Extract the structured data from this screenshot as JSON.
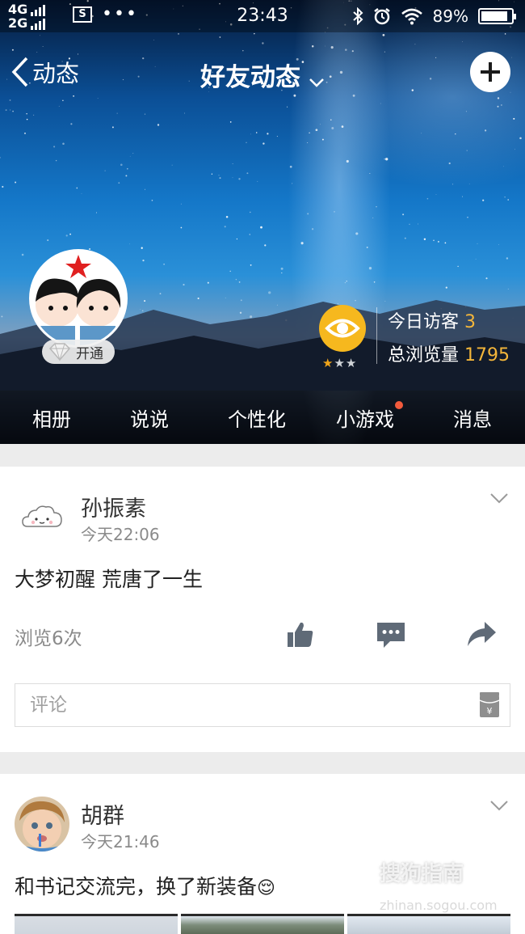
{
  "status_bar": {
    "network_top": "4G",
    "network_bottom": "2G",
    "sim_icon": "S",
    "more": "•••",
    "time": "23:43",
    "battery": "89%",
    "battery_level": 0.89,
    "icons": [
      "bluetooth-icon",
      "alarm-icon",
      "wifi-icon",
      "battery-icon"
    ]
  },
  "header": {
    "back_label": "动态",
    "title": "好友动态",
    "add_icon": "plus-icon"
  },
  "profile": {
    "vip_label": "开通",
    "visits_today_label": "今日访客",
    "visits_today": "3",
    "visits_total_label": "总浏览量",
    "visits_total": "1795",
    "rating_stars": 1,
    "rating_max": 3
  },
  "nav": {
    "items": [
      {
        "label": "相册"
      },
      {
        "label": "说说"
      },
      {
        "label": "个性化"
      },
      {
        "label": "小游戏",
        "badge": true
      },
      {
        "label": "消息"
      }
    ]
  },
  "posts": [
    {
      "name": "孙振素",
      "time": "今天22:06",
      "text": "大梦初醒 荒唐了一生",
      "views": "浏览6次",
      "comment_placeholder": "评论"
    },
    {
      "name": "胡群",
      "time": "今天21:46",
      "text": "和书记交流完，换了新装备",
      "emoji": "😌"
    }
  ],
  "watermark": {
    "text": "搜狗指南",
    "url": "zhinan.sogou.com"
  },
  "colors": {
    "accent_orange": "#f4b63a",
    "eye_badge": "#f6b81e",
    "badge_red": "#f25a3c"
  }
}
